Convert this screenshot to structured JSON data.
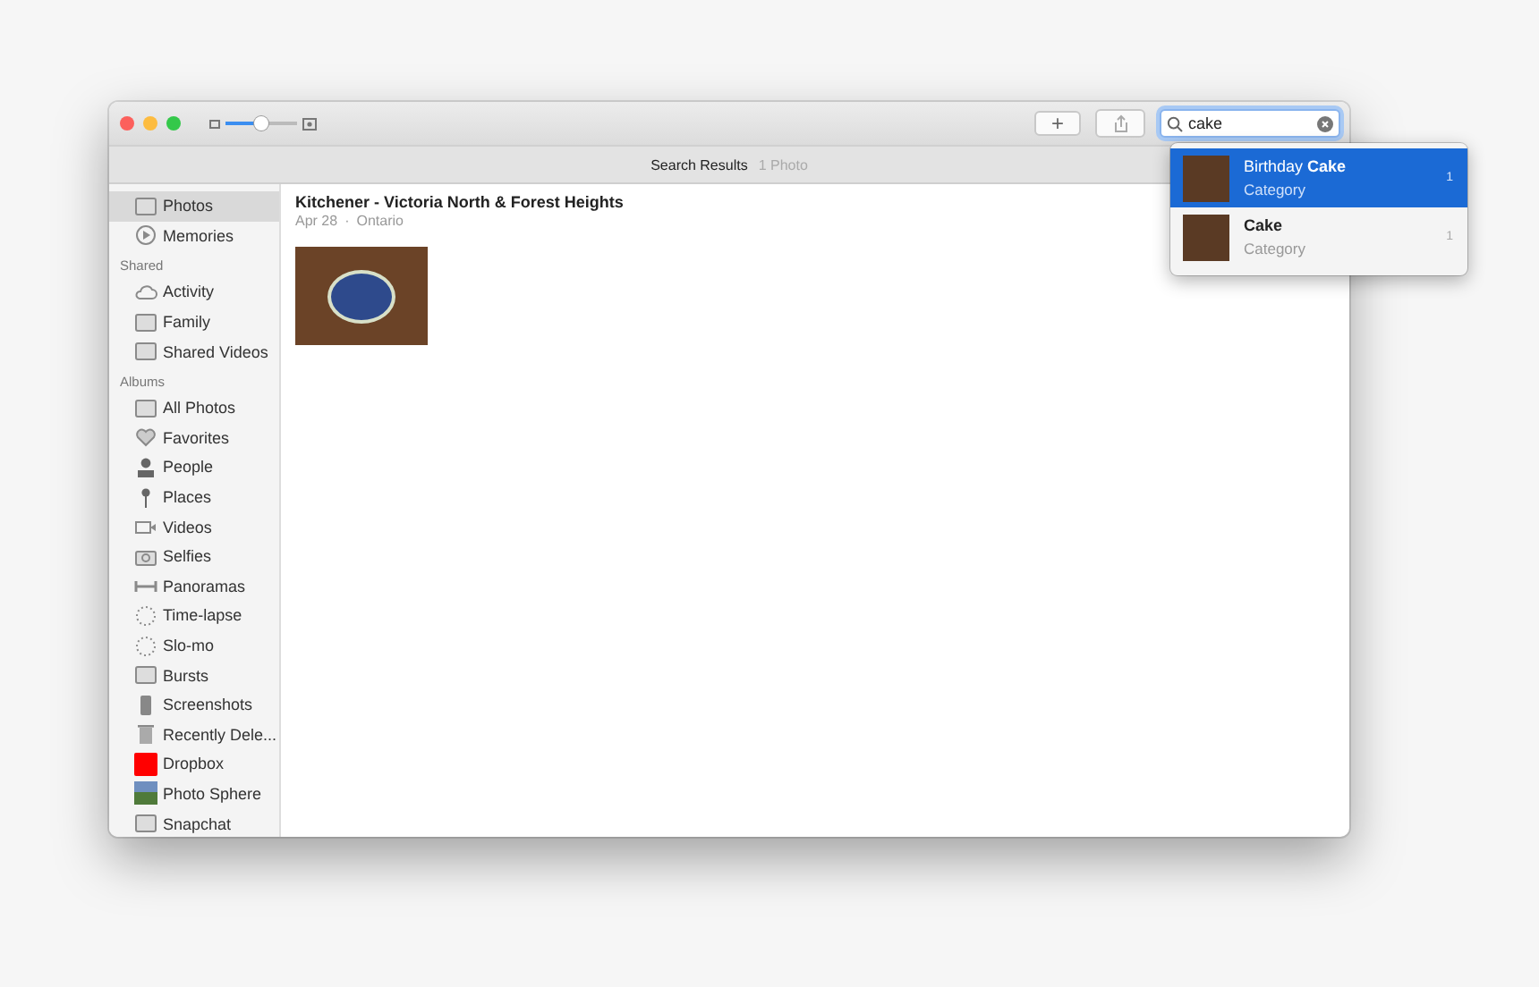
{
  "toolbar": {
    "zoom_slider": {
      "level": 0.5
    },
    "add_button": "+",
    "search": {
      "value": "cake"
    }
  },
  "subtitle": {
    "title": "Search Results",
    "count": "1 Photo"
  },
  "sidebar": {
    "sections": [
      {
        "items": [
          {
            "label": "Photos",
            "kind": "photos",
            "selected": true
          },
          {
            "label": "Memories",
            "kind": "memories",
            "selected": false
          }
        ]
      },
      {
        "heading": "Shared",
        "items": [
          {
            "label": "Activity",
            "kind": "cloud",
            "selected": false
          },
          {
            "label": "Family",
            "kind": "album",
            "selected": false
          },
          {
            "label": "Shared Videos",
            "kind": "album",
            "selected": false
          }
        ]
      },
      {
        "heading": "Albums",
        "items": [
          {
            "label": "All Photos",
            "kind": "album",
            "selected": false
          },
          {
            "label": "Favorites",
            "kind": "heart",
            "selected": false
          },
          {
            "label": "People",
            "kind": "person",
            "selected": false
          },
          {
            "label": "Places",
            "kind": "pin",
            "selected": false
          },
          {
            "label": "Videos",
            "kind": "video",
            "selected": false
          },
          {
            "label": "Selfies",
            "kind": "camera",
            "selected": false
          },
          {
            "label": "Panoramas",
            "kind": "panorama",
            "selected": false
          },
          {
            "label": "Time-lapse",
            "kind": "dots",
            "selected": false
          },
          {
            "label": "Slo-mo",
            "kind": "dots",
            "selected": false
          },
          {
            "label": "Bursts",
            "kind": "album",
            "selected": false
          },
          {
            "label": "Screenshots",
            "kind": "phone",
            "selected": false
          },
          {
            "label": "Recently Dele...",
            "kind": "trash",
            "selected": false
          },
          {
            "label": "Dropbox",
            "kind": "square",
            "selected": false
          },
          {
            "label": "Photo Sphere",
            "kind": "landscape",
            "selected": false
          },
          {
            "label": "Snapchat",
            "kind": "album",
            "selected": false
          }
        ]
      }
    ]
  },
  "moment": {
    "title": "Kitchener - Victoria North & Forest Heights",
    "date": "Apr 28",
    "separator": "·",
    "place": "Ontario"
  },
  "suggestions": [
    {
      "title": "Birthday **Cake**",
      "subtitle": "Category",
      "count": "1",
      "selected": true
    },
    {
      "title": "Cake",
      "subtitle": "Category",
      "count": "1",
      "selected": false
    }
  ]
}
